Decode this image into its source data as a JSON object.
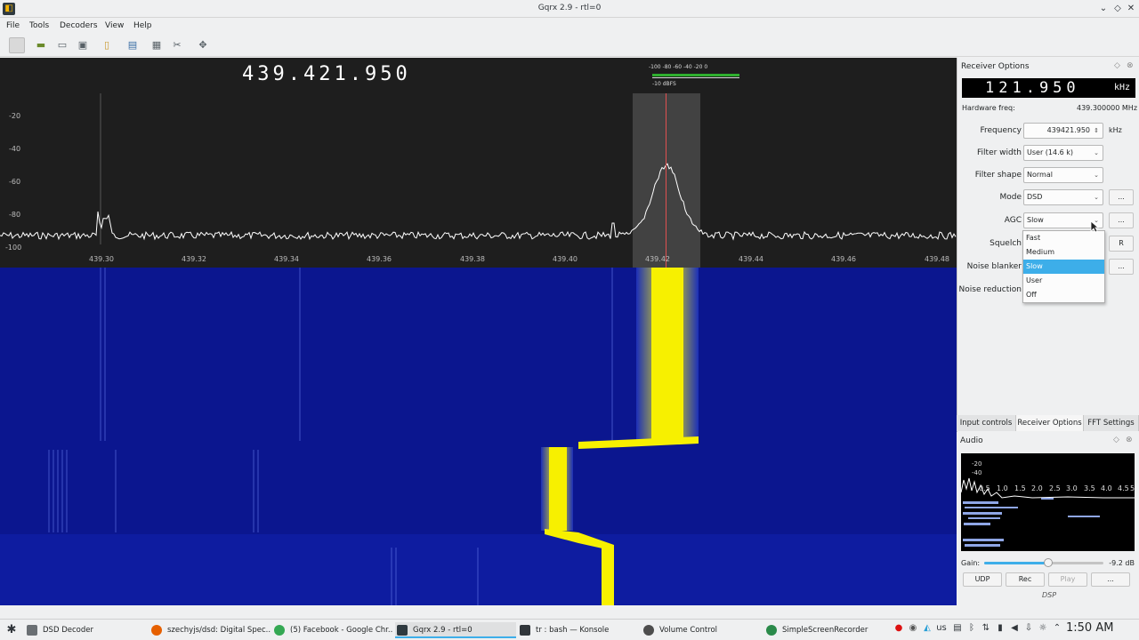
{
  "window": {
    "title": "Gqrx 2.9 - rtl=0"
  },
  "menu": [
    "File",
    "Tools",
    "Decoders",
    "View",
    "Help"
  ],
  "spectrum": {
    "frequency_display": "439.421.950",
    "db_labels": [
      "-20",
      "-40",
      "-60",
      "-80",
      "-100"
    ],
    "freq_ticks": [
      "439.30",
      "439.32",
      "439.34",
      "439.36",
      "439.38",
      "439.40",
      "439.42",
      "439.44",
      "439.46",
      "439.48"
    ],
    "meter_scale": "-100  -80  -60  -40  -20   0",
    "meter_label": "-10 dBFS"
  },
  "receiver_options": {
    "title": "Receiver Options",
    "offset_display": "121.950",
    "offset_unit": "kHz",
    "hardware_freq_label": "Hardware freq:",
    "hardware_freq_value": "439.300000 MHz",
    "frequency_label": "Frequency",
    "frequency_value": "439421.950",
    "frequency_unit": "kHz",
    "filter_width_label": "Filter width",
    "filter_width_value": "User (14.6 k)",
    "filter_shape_label": "Filter shape",
    "filter_shape_value": "Normal",
    "mode_label": "Mode",
    "mode_value": "DSD",
    "agc_label": "AGC",
    "agc_value": "Slow",
    "squelch_label": "Squelch",
    "noise_blanker_label": "Noise blanker",
    "noise_reduction_label": "Noise reduction",
    "more_button": "...",
    "reset_button": "R",
    "agc_options": [
      "Fast",
      "Medium",
      "Slow",
      "User",
      "Off"
    ],
    "agc_selected_index": 2
  },
  "dock_tabs": [
    "Input controls",
    "Receiver Options",
    "FFT Settings"
  ],
  "active_tab": "Receiver Options",
  "audio": {
    "title": "Audio",
    "fft_labels": [
      "-20",
      "-40",
      "0.5",
      "1.0",
      "1.5",
      "2.0",
      "2.5",
      "3.0",
      "3.5",
      "4.0",
      "4.5",
      "5"
    ],
    "gain_label": "Gain:",
    "gain_value": "-9.2 dB",
    "gain_level": 0.54,
    "buttons": [
      "UDP",
      "Rec",
      "Play",
      "..."
    ],
    "dsp_label": "DSP"
  },
  "taskbar": {
    "tasks": [
      "DSD Decoder",
      "szechyjs/dsd: Digital Spec...",
      "(5) Facebook - Google Chr...",
      "Gqrx 2.9 - rtl=0",
      "tr : bash — Konsole",
      "Volume Control",
      "SimpleScreenRecorder"
    ],
    "keyboard_layout": "us",
    "clock": "1:50 AM"
  },
  "colors": {
    "accent": "#3daee9",
    "spectrum_bg": "#1e1e1e",
    "waterfall_bg": "#0a1590",
    "signal": "#f7f000",
    "center_line": "#e05050"
  }
}
